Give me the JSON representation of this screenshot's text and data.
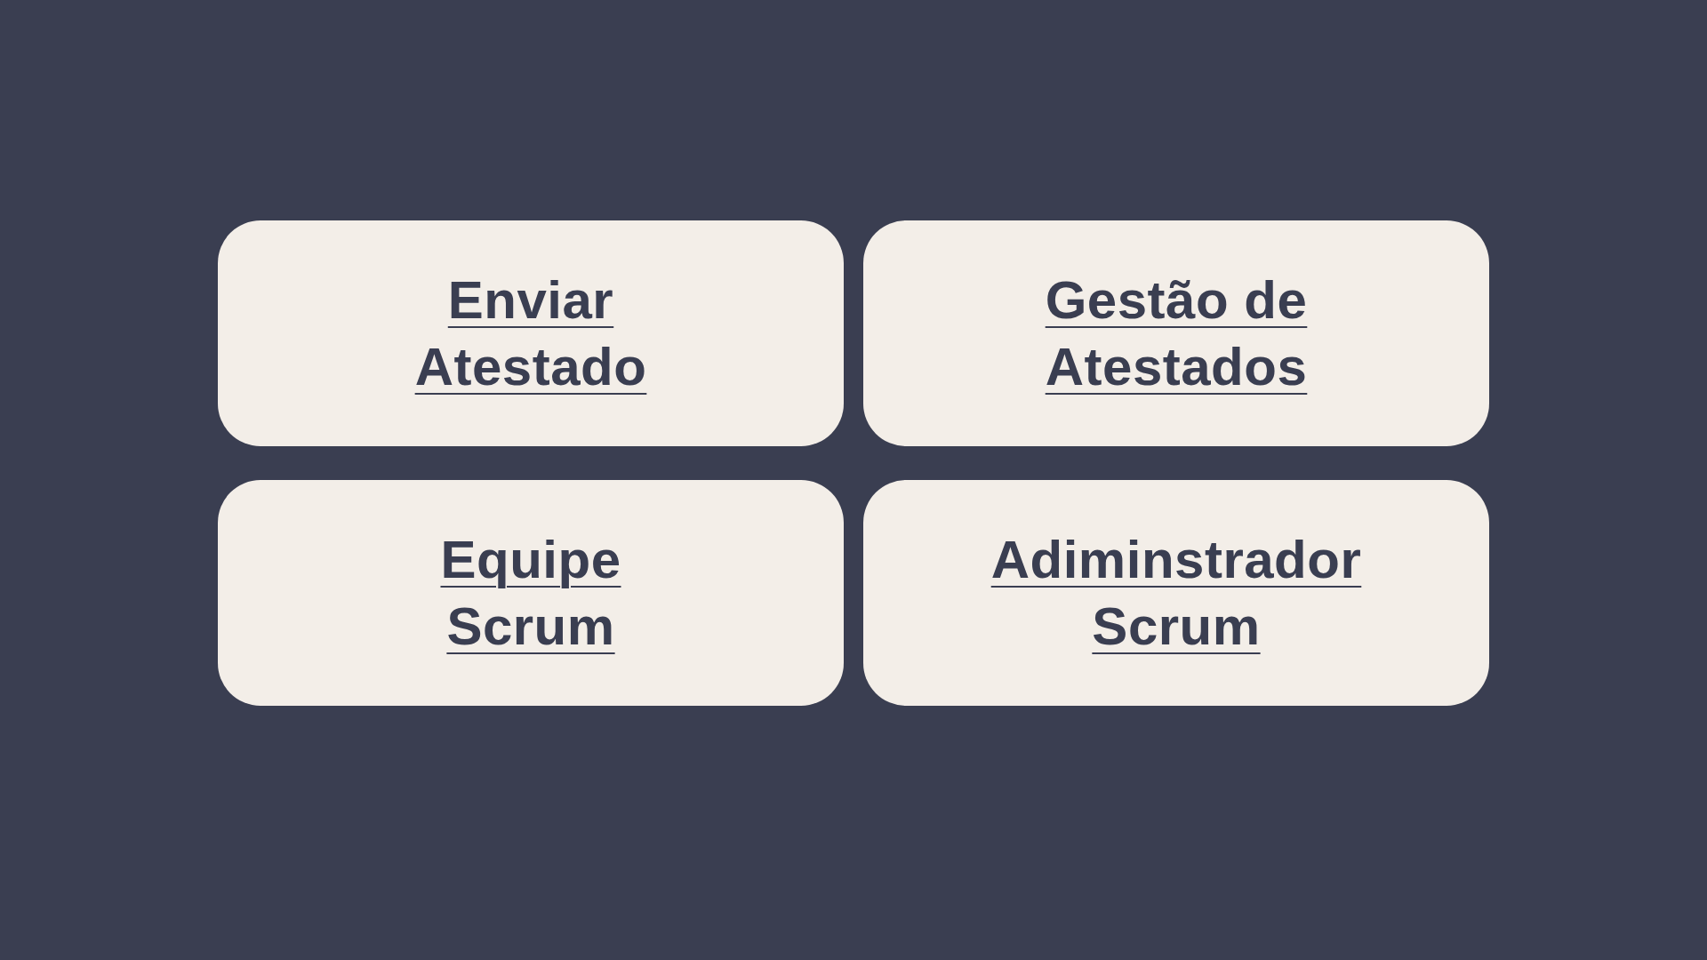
{
  "menu": {
    "cards": [
      {
        "label": "Enviar Atestado"
      },
      {
        "label": "Gestão de Atestados"
      },
      {
        "label": "Equipe Scrum"
      },
      {
        "label": "Adiminstrador Scrum"
      }
    ]
  }
}
